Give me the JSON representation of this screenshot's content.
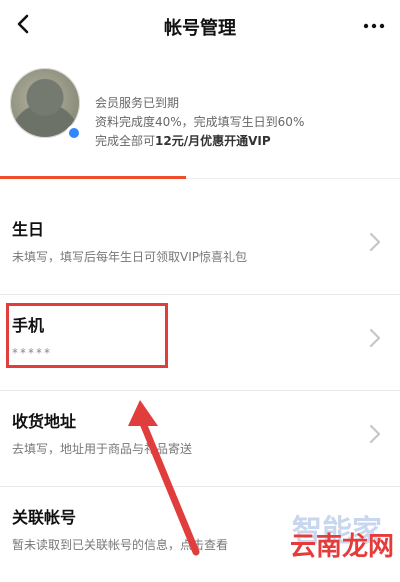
{
  "header": {
    "title": "帐号管理"
  },
  "profile": {
    "line1": "会员服务已到期",
    "line2": "资料完成度40%，完成填写生日到60%",
    "line3_prefix": "完成全部可",
    "line3_strong": "12元/月优惠开通VIP",
    "completion_percent": 40
  },
  "rows": [
    {
      "title": "生日",
      "subtitle": "未填写，填写后每年生日可领取VIP惊喜礼包"
    },
    {
      "title": "手机",
      "subtitle": "*****"
    },
    {
      "title": "收货地址",
      "subtitle": "去填写，地址用于商品与礼品寄送"
    },
    {
      "title": "关联帐号",
      "subtitle": "暂未读取到已关联帐号的信息，点击查看"
    }
  ],
  "watermark": {
    "top": "智能家",
    "bottom": "云南龙网"
  },
  "colors": {
    "accent_red": "#e23d3d",
    "progress_orange": "#ef4d2b",
    "badge_blue": "#2f86ff"
  },
  "icons": {
    "back": "chevron-left-icon",
    "more": "more-dots-icon",
    "row_chevron": "chevron-right-icon"
  }
}
